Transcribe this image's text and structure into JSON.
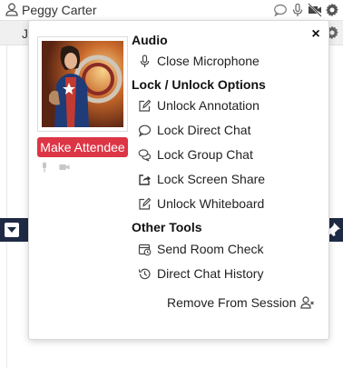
{
  "participant_list": {
    "row1_name": "Peggy Carter",
    "row2_initial": "J"
  },
  "popup": {
    "close_glyph": "×",
    "attendee_button_label": "Make Attendee",
    "sections": {
      "audio": "Audio",
      "lock_unlock": "Lock / Unlock Options",
      "other_tools": "Other Tools"
    },
    "items": {
      "close_microphone": "Close Microphone",
      "unlock_annotation": "Unlock Annotation",
      "lock_direct_chat": "Lock Direct Chat",
      "lock_group_chat": "Lock Group Chat",
      "lock_screen_share": "Lock Screen Share",
      "unlock_whiteboard": "Unlock Whiteboard",
      "send_room_check": "Send Room Check",
      "direct_chat_history": "Direct Chat History",
      "remove_from_session": "Remove From Session"
    }
  },
  "colors": {
    "attendee_button": "#dc3545",
    "dark_bar": "#1e2a44"
  },
  "icons": [
    "person-icon",
    "chat-icon",
    "microphone-icon",
    "video-off-icon",
    "gear-icon",
    "close-icon",
    "pencil-square-icon",
    "chat-bubble-icon",
    "chat-bubbles-icon",
    "share-icon",
    "room-check-icon",
    "history-icon",
    "user-remove-icon",
    "pin-icon",
    "dropdown-icon"
  ]
}
